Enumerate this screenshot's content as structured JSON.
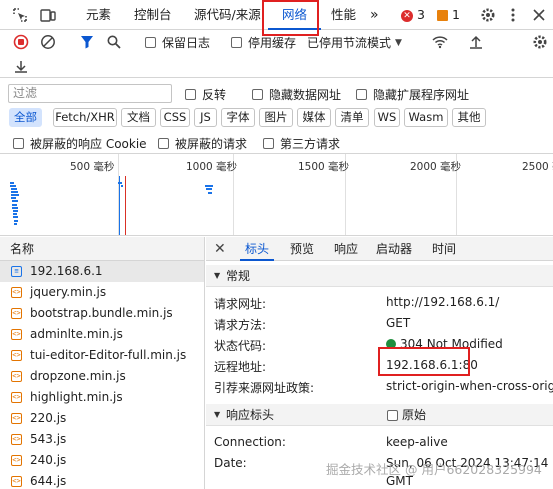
{
  "tabs": [
    {
      "label": "元素"
    },
    {
      "label": "控制台"
    },
    {
      "label": "源代码/来源"
    },
    {
      "label": "网络"
    },
    {
      "label": "性能"
    }
  ],
  "badges": {
    "errors": "3",
    "warnings": "1"
  },
  "toolbar": {
    "preserve_log": "保留日志",
    "disable_cache": "停用缓存",
    "throttle": "已停用节流模式"
  },
  "filter": {
    "placeholder": "过滤",
    "invert": "反转",
    "hide_data_urls": "隐藏数据网址",
    "hide_ext_urls": "隐藏扩展程序网址"
  },
  "types": [
    "全部",
    "Fetch/XHR",
    "文档",
    "CSS",
    "JS",
    "字体",
    "图片",
    "媒体",
    "清单",
    "WS",
    "Wasm",
    "其他"
  ],
  "blocked": {
    "blocked_cookies": "被屏蔽的响应 Cookie",
    "blocked_requests": "被屏蔽的请求",
    "third_party": "第三方请求"
  },
  "timeline": {
    "ticks": [
      "500 毫秒",
      "1000 毫秒",
      "1500 毫秒",
      "2000 毫秒",
      "2500 毫秒"
    ]
  },
  "list": {
    "header": "名称",
    "items": [
      {
        "name": "192.168.6.1",
        "type": "doc"
      },
      {
        "name": "jquery.min.js",
        "type": "js"
      },
      {
        "name": "bootstrap.bundle.min.js",
        "type": "js"
      },
      {
        "name": "adminlte.min.js",
        "type": "js"
      },
      {
        "name": "tui-editor-Editor-full.min.js",
        "type": "js"
      },
      {
        "name": "dropzone.min.js",
        "type": "js"
      },
      {
        "name": "highlight.min.js",
        "type": "js"
      },
      {
        "name": "220.js",
        "type": "js"
      },
      {
        "name": "543.js",
        "type": "js"
      },
      {
        "name": "240.js",
        "type": "js"
      },
      {
        "name": "644.js",
        "type": "js"
      }
    ]
  },
  "details": {
    "tabs": [
      "标头",
      "预览",
      "响应",
      "启动器",
      "时间"
    ],
    "general_title": "常规",
    "general": [
      {
        "k": "请求网址:",
        "v": "http://192.168.6.1/"
      },
      {
        "k": "请求方法:",
        "v": "GET"
      },
      {
        "k": "状态代码:",
        "v": "304 Not Modified"
      },
      {
        "k": "远程地址:",
        "v": "192.168.6.1:80"
      },
      {
        "k": "引荐来源网址政策:",
        "v": "strict-origin-when-cross-origin"
      }
    ],
    "response_title": "响应标头",
    "raw_label": "原始",
    "response": [
      {
        "k": "Connection:",
        "v": "keep-alive"
      },
      {
        "k": "Date:",
        "v": "Sun, 06 Oct 2024 13:47:14"
      },
      {
        "k": "",
        "v": "GMT"
      }
    ]
  },
  "watermark": "掘金技术社区 @ 用户662028325994"
}
